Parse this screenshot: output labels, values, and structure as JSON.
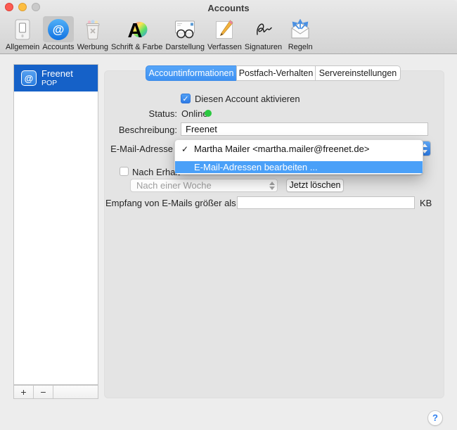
{
  "window": {
    "title": "Accounts"
  },
  "toolbar": {
    "items": [
      {
        "label": "Allgemein",
        "icon": "switch-icon",
        "selected": false
      },
      {
        "label": "Accounts",
        "icon": "at-icon",
        "selected": true
      },
      {
        "label": "Werbung",
        "icon": "trash-icon",
        "selected": false
      },
      {
        "label": "Schrift & Farbe",
        "icon": "font-color-icon",
        "selected": false
      },
      {
        "label": "Darstellung",
        "icon": "glasses-envelope-icon",
        "selected": false
      },
      {
        "label": "Verfassen",
        "icon": "pencil-icon",
        "selected": false
      },
      {
        "label": "Signaturen",
        "icon": "signature-icon",
        "selected": false
      },
      {
        "label": "Regeln",
        "icon": "envelope-arrows-icon",
        "selected": false
      }
    ]
  },
  "sidebar": {
    "accounts": [
      {
        "name": "Freenet",
        "protocol": "POP",
        "selected": true
      }
    ],
    "actions": {
      "add": "+",
      "remove": "−"
    }
  },
  "tabs": {
    "items": [
      {
        "label": "Accountinformationen",
        "selected": true
      },
      {
        "label": "Postfach-Verhalten",
        "selected": false
      },
      {
        "label": "Servereinstellungen",
        "selected": false
      }
    ]
  },
  "form": {
    "enable_account": {
      "label": "Diesen Account aktivieren",
      "checked": true
    },
    "status": {
      "label": "Status:",
      "value": "Online",
      "indicator_color": "#2bc840"
    },
    "description": {
      "label": "Beschreibung:",
      "value": "Freenet"
    },
    "email_address": {
      "label": "E-Mail-Adresse",
      "menu_open": true,
      "menu": {
        "items": [
          {
            "label": "Martha Mailer <martha.mailer@freenet.de>",
            "checked": true,
            "highlighted": false
          },
          {
            "label": "E-Mail-Adressen bearbeiten ...",
            "checked": false,
            "highlighted": true
          }
        ]
      }
    },
    "delete_after_receive": {
      "label": "Nach Erhalt",
      "checked": false
    },
    "delete_interval": {
      "value": "Nach einer Woche",
      "disabled": true
    },
    "delete_now": {
      "label": "Jetzt löschen"
    },
    "size_limit": {
      "label": "Empfang von E-Mails größer als",
      "value": "",
      "unit": "KB"
    }
  },
  "help": {
    "label": "?"
  },
  "glyphs": {
    "check": "✓",
    "at": "@"
  },
  "colors": {
    "selection_blue": "#4aa0f8",
    "sidebar_selection": "#1561c8",
    "tab_selected": "#459af4",
    "status_green": "#2bc840"
  }
}
